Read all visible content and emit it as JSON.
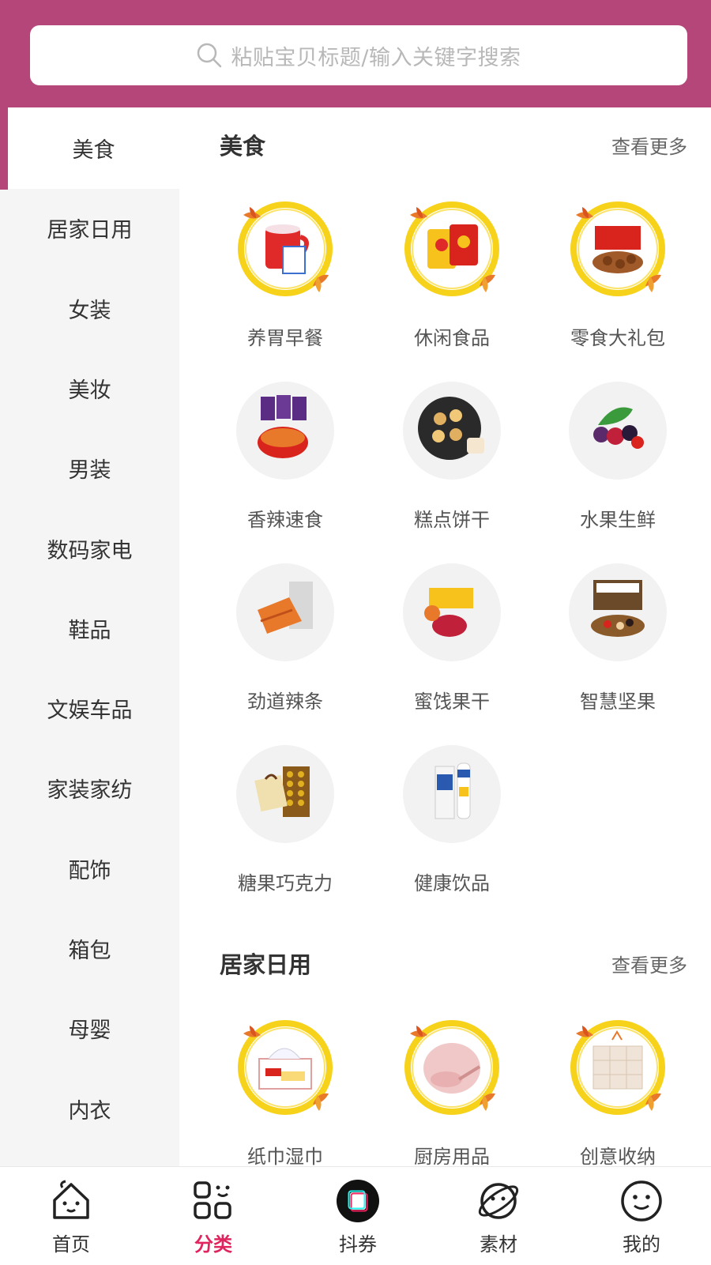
{
  "colors": {
    "brand": "#b5467a",
    "active_tab": "#e0245e",
    "sidebar_bg": "#f5f5f5"
  },
  "search": {
    "placeholder": "粘贴宝贝标题/输入关键字搜索",
    "icon": "search-icon"
  },
  "sidebar": {
    "active_index": 0,
    "items": [
      {
        "label": "美食"
      },
      {
        "label": "居家日用"
      },
      {
        "label": "女装"
      },
      {
        "label": "美妆"
      },
      {
        "label": "男装"
      },
      {
        "label": "数码家电"
      },
      {
        "label": "鞋品"
      },
      {
        "label": "文娱车品"
      },
      {
        "label": "家装家纺"
      },
      {
        "label": "配饰"
      },
      {
        "label": "箱包"
      },
      {
        "label": "母婴"
      },
      {
        "label": "内衣"
      }
    ]
  },
  "sections": [
    {
      "title": "美食",
      "more": "查看更多",
      "items": [
        {
          "label": "养胃早餐",
          "icon": "breakfast-cup-icon"
        },
        {
          "label": "休闲食品",
          "icon": "snack-bags-icon"
        },
        {
          "label": "零食大礼包",
          "icon": "gift-box-icon"
        },
        {
          "label": "香辣速食",
          "icon": "spicy-noodle-icon"
        },
        {
          "label": "糕点饼干",
          "icon": "cookie-tin-icon"
        },
        {
          "label": "水果生鲜",
          "icon": "fresh-berries-icon"
        },
        {
          "label": "劲道辣条",
          "icon": "spicy-strip-icon"
        },
        {
          "label": "蜜饯果干",
          "icon": "dried-fruit-icon"
        },
        {
          "label": "智慧坚果",
          "icon": "nut-box-icon"
        },
        {
          "label": "糖果巧克力",
          "icon": "chocolate-box-icon"
        },
        {
          "label": "健康饮品",
          "icon": "milk-drink-icon"
        }
      ]
    },
    {
      "title": "居家日用",
      "more": "查看更多",
      "items": [
        {
          "label": "纸巾湿巾",
          "icon": "tissue-box-icon"
        },
        {
          "label": "厨房用品",
          "icon": "kitchen-pot-icon"
        },
        {
          "label": "创意收纳",
          "icon": "storage-drawer-icon"
        }
      ]
    }
  ],
  "tabbar": {
    "active_index": 1,
    "items": [
      {
        "label": "首页",
        "icon": "home-icon"
      },
      {
        "label": "分类",
        "icon": "category-grid-icon"
      },
      {
        "label": "抖券",
        "icon": "douyin-coupon-icon"
      },
      {
        "label": "素材",
        "icon": "planet-icon"
      },
      {
        "label": "我的",
        "icon": "smiley-profile-icon"
      }
    ]
  }
}
